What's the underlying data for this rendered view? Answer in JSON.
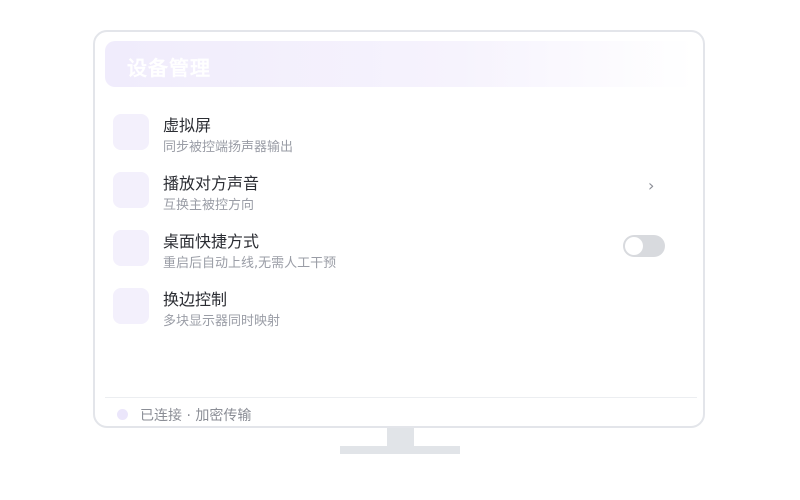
{
  "header": {
    "title": "设备管理"
  },
  "items": [
    {
      "title": "虚拟屏",
      "subtitle": "同步被控端扬声器输出",
      "icon": "feature-icon"
    },
    {
      "title": "播放对方声音",
      "subtitle": "互换主被控方向",
      "icon": "feature-icon",
      "chevron": "›"
    },
    {
      "title": "桌面快捷方式",
      "subtitle": "重启后自动上线,无需人工干预",
      "icon": "feature-icon",
      "toggle_on": false
    },
    {
      "title": "换边控制",
      "subtitle": "多块显示器同时映射",
      "icon": "feature-icon"
    }
  ],
  "status": {
    "text": "已连接 · 加密传输"
  },
  "colors": {
    "accent": "#f3f0fc",
    "frame": "#e3e5ea",
    "toggle_off": "#d8dade"
  }
}
